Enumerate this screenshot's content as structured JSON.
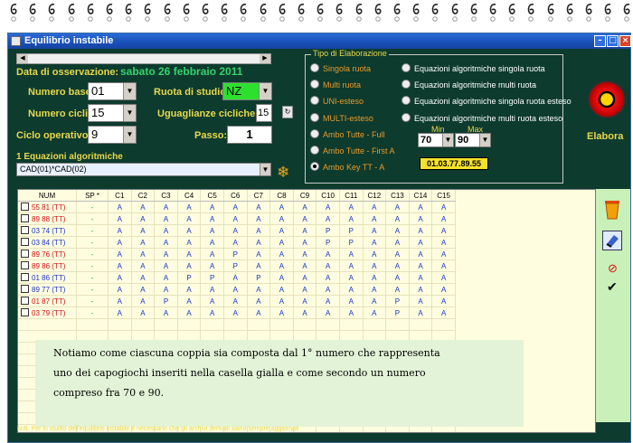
{
  "window": {
    "title": "Equilibrio instabile"
  },
  "controls": {
    "data_label": "Data di osservazione:",
    "date": "sabato 26 febbraio 2011",
    "numero_base_label": "Numero base:",
    "numero_base": "01",
    "ruota_label": "Ruota di studio:",
    "ruota": "NZ",
    "numero_cicli_label": "Numero cicli:",
    "numero_cicli": "15",
    "uguaglianze_label": "Uguaglianze cicliche:",
    "uguaglianze": "15",
    "ciclo_label": "Ciclo operativo:",
    "ciclo": "9",
    "passo_label": "Passo:",
    "passo": "1",
    "equazioni_label": "1 Equazioni algoritmiche",
    "equazione": "CAD(01)*CAD(02)"
  },
  "elaborazione": {
    "title": "Tipo di Elaborazione",
    "left": [
      {
        "label": "Singola ruota",
        "selected": false
      },
      {
        "label": "Multi ruota",
        "selected": false
      },
      {
        "label": "UNI-esteso",
        "selected": false
      },
      {
        "label": "MULTI-esteso",
        "selected": false
      },
      {
        "label": "Ambo Tutte - Full",
        "selected": false
      },
      {
        "label": "Ambo Tutte - First A",
        "selected": false
      },
      {
        "label": "Ambo Key TT -  A",
        "selected": true
      }
    ],
    "right": [
      {
        "label": "Equazioni algoritmiche singola ruota",
        "selected": false
      },
      {
        "label": "Equazioni algoritmiche multi ruota",
        "selected": false
      },
      {
        "label": "Equazioni algoritmiche singola ruota esteso",
        "selected": false
      },
      {
        "label": "Equazioni algoritmiche multi ruota esteso",
        "selected": false
      }
    ],
    "min_label": "Min",
    "min": "70",
    "max_label": "Max",
    "max": "90",
    "key": "01.03.77.89.55"
  },
  "elabora_label": "Elabora",
  "table": {
    "headers": [
      "NUM",
      "SP *",
      "C1",
      "C2",
      "C3",
      "C4",
      "C5",
      "C6",
      "C7",
      "C8",
      "C9",
      "C10",
      "C11",
      "C12",
      "C13",
      "C14",
      "C15"
    ],
    "rows": [
      {
        "num": "55 81",
        "tag": "(TT)",
        "color": "red",
        "sp": "-",
        "cells": [
          "A",
          "A",
          "A",
          "A",
          "A",
          "A",
          "A",
          "A",
          "A",
          "A",
          "A",
          "A",
          "A",
          "A",
          "A"
        ]
      },
      {
        "num": "89 88",
        "tag": "(TT)",
        "color": "red",
        "sp": "-",
        "cells": [
          "A",
          "A",
          "A",
          "A",
          "A",
          "A",
          "A",
          "A",
          "A",
          "A",
          "A",
          "A",
          "A",
          "A",
          "A"
        ]
      },
      {
        "num": "03 74",
        "tag": "(TT)",
        "color": "blue",
        "sp": "-",
        "cells": [
          "A",
          "A",
          "A",
          "A",
          "A",
          "A",
          "A",
          "A",
          "A",
          "P",
          "P",
          "A",
          "A",
          "A",
          "A"
        ]
      },
      {
        "num": "03 84",
        "tag": "(TT)",
        "color": "blue",
        "sp": "-",
        "cells": [
          "A",
          "A",
          "A",
          "A",
          "A",
          "A",
          "A",
          "A",
          "A",
          "P",
          "P",
          "A",
          "A",
          "A",
          "A"
        ]
      },
      {
        "num": "89 76",
        "tag": "(TT)",
        "color": "red",
        "sp": "-",
        "cells": [
          "A",
          "A",
          "A",
          "A",
          "A",
          "P",
          "A",
          "A",
          "A",
          "A",
          "A",
          "A",
          "A",
          "A",
          "A"
        ]
      },
      {
        "num": "89 86",
        "tag": "(TT)",
        "color": "red",
        "sp": "-",
        "cells": [
          "A",
          "A",
          "A",
          "A",
          "A",
          "P",
          "A",
          "A",
          "A",
          "A",
          "A",
          "A",
          "A",
          "A",
          "A"
        ]
      },
      {
        "num": "01 86",
        "tag": "(TT)",
        "color": "blue",
        "sp": "-",
        "cells": [
          "A",
          "A",
          "A",
          "P",
          "P",
          "A",
          "P",
          "A",
          "A",
          "A",
          "A",
          "A",
          "A",
          "A",
          "A"
        ]
      },
      {
        "num": "89 77",
        "tag": "(TT)",
        "color": "blue",
        "sp": "-",
        "cells": [
          "A",
          "A",
          "A",
          "A",
          "A",
          "A",
          "A",
          "A",
          "A",
          "A",
          "A",
          "A",
          "A",
          "A",
          "A"
        ]
      },
      {
        "num": "01 87",
        "tag": "(TT)",
        "color": "red",
        "sp": "-",
        "cells": [
          "A",
          "A",
          "P",
          "A",
          "A",
          "A",
          "A",
          "A",
          "A",
          "A",
          "A",
          "A",
          "P",
          "A",
          "A"
        ]
      },
      {
        "num": "03 79",
        "tag": "(TT)",
        "color": "red",
        "sp": "-",
        "cells": [
          "A",
          "A",
          "A",
          "A",
          "A",
          "A",
          "A",
          "A",
          "A",
          "A",
          "A",
          "A",
          "P",
          "A",
          "A"
        ]
      }
    ]
  },
  "note": {
    "line1": "Notiamo come ciascuna coppia sia composta dal 1° numero che rappresenta",
    "line2": "uno dei capogiochi inseriti nella casella gialla e come secondo un numero",
    "line3": "compreso fra 70 e 90."
  },
  "footer": "N.B. Per lo studio dell'equilibrio instabile è necessario che gli archivi derivati siano sempre aggiornati"
}
